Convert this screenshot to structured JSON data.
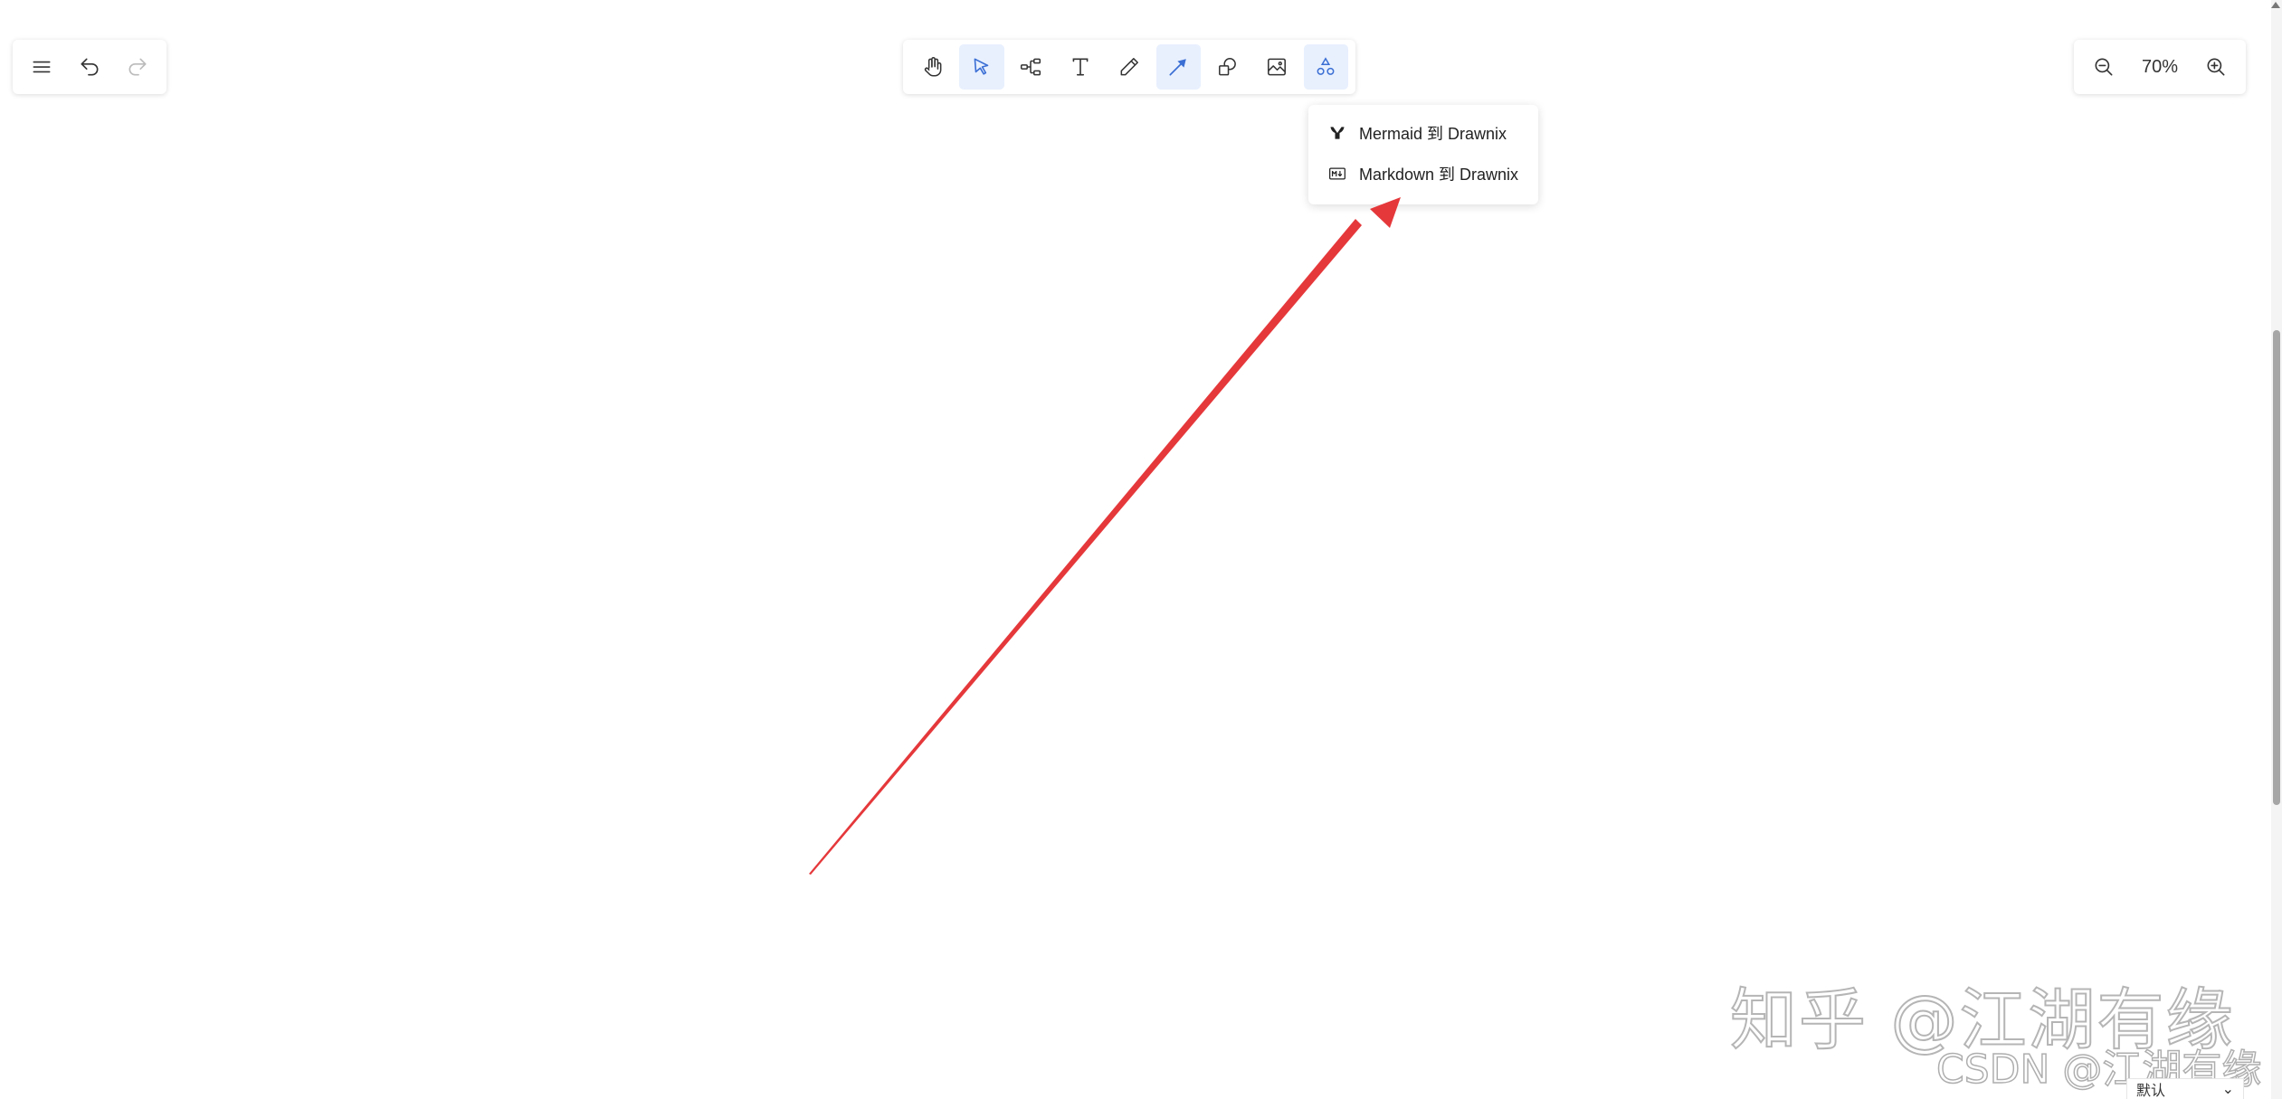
{
  "app_menu": {
    "menu_icon": "hamburger-icon",
    "undo_icon": "undo-icon",
    "redo_icon": "redo-icon"
  },
  "toolbar": {
    "tools": [
      {
        "name": "hand",
        "icon": "hand-icon"
      },
      {
        "name": "selection",
        "icon": "pointer-icon",
        "active": true
      },
      {
        "name": "mind-map",
        "icon": "mindmap-icon"
      },
      {
        "name": "text",
        "icon": "text-icon"
      },
      {
        "name": "pen",
        "icon": "pencil-icon"
      },
      {
        "name": "arrow",
        "icon": "arrow-icon",
        "active": true
      },
      {
        "name": "shape",
        "icon": "shapes-icon"
      },
      {
        "name": "image",
        "icon": "image-icon"
      },
      {
        "name": "extra-tools",
        "icon": "extra-tools-icon",
        "active": true
      }
    ]
  },
  "zoom": {
    "level": "70%",
    "zoom_out_icon": "zoom-out-icon",
    "zoom_in_icon": "zoom-in-icon"
  },
  "dropdown": {
    "items": [
      {
        "label": "Mermaid 到 Drawnix",
        "icon": "mermaid-icon"
      },
      {
        "label": "Markdown 到 Drawnix",
        "icon": "markdown-icon"
      }
    ]
  },
  "annotation": {
    "arrow_color": "#e5383b"
  },
  "watermark": {
    "main": "知乎 @江湖有缘",
    "sub": "CSDN @江湖有缘"
  },
  "corner_fragment": {
    "label": "默认"
  },
  "colors": {
    "accent": "#3b6fd4",
    "active_bg": "#e8f0fe"
  }
}
